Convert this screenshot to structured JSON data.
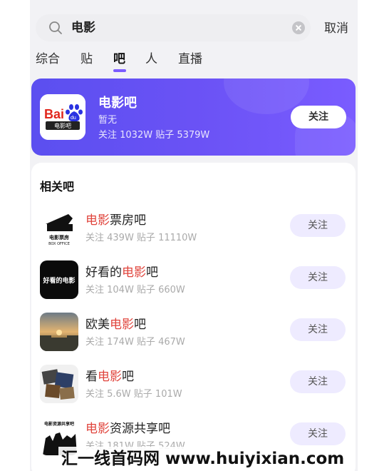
{
  "search": {
    "query": "电影",
    "cancel_label": "取消"
  },
  "tabs": [
    {
      "label": "综合"
    },
    {
      "label": "贴"
    },
    {
      "label": "吧"
    },
    {
      "label": "人"
    },
    {
      "label": "直播"
    }
  ],
  "active_tab": "吧",
  "accent_color": "#7b5cff",
  "highlight_color": "#e0443c",
  "feature": {
    "name": "电影吧",
    "desc": "暂无",
    "stats": "关注 1032W   贴子 5379W",
    "follow_label": "关注",
    "logo_text": "Bai du",
    "logo_sub": "电影吧"
  },
  "related": {
    "title": "相关吧",
    "items": [
      {
        "name_hl": "电影",
        "name_rest": "票房吧",
        "name_pre": "",
        "stats": "关注 439W 贴子 11110W",
        "follow_label": "关注",
        "avatar_text": "电影票房",
        "avatar_sub": "BOX OFFICE"
      },
      {
        "name_pre": "好看的",
        "name_hl": "电影",
        "name_rest": "吧",
        "stats": "关注 104W 贴子 660W",
        "follow_label": "关注",
        "avatar_text": "好看的电影"
      },
      {
        "name_pre": "欧美",
        "name_hl": "电影",
        "name_rest": "吧",
        "stats": "关注 174W 贴子 467W",
        "follow_label": "关注"
      },
      {
        "name_pre": "看",
        "name_hl": "电影",
        "name_rest": "吧",
        "stats": "关注 5.6W 贴子 101W",
        "follow_label": "关注"
      },
      {
        "name_pre": "",
        "name_hl": "电影",
        "name_rest": "资源共享吧",
        "stats": "关注 181W 贴子 524W",
        "follow_label": "关注",
        "avatar_text": "电影资源共享吧"
      }
    ]
  },
  "watermark": "汇一线首码网 www.huiyixian.com"
}
